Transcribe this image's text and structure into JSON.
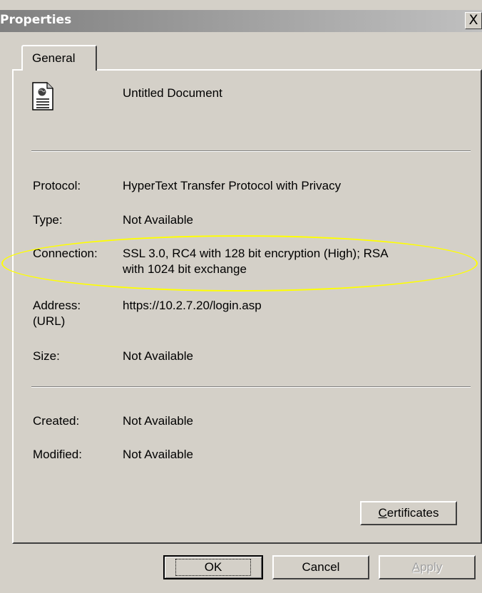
{
  "window": {
    "title": "Properties",
    "close_glyph": "X"
  },
  "tabs": [
    {
      "label": "General",
      "selected": true
    }
  ],
  "document": {
    "icon": "web-document-icon",
    "name": "Untitled Document"
  },
  "fields": {
    "protocol": {
      "label": "Protocol:",
      "value": "HyperText Transfer Protocol with Privacy"
    },
    "type": {
      "label": "Type:",
      "value": "Not Available"
    },
    "connection": {
      "label": "Connection:",
      "value_line1": "SSL 3.0, RC4 with 128 bit encryption (High); RSA",
      "value_line2": "with 1024 bit exchange"
    },
    "address": {
      "label_line1": "Address:",
      "label_line2": "(URL)",
      "value": "https://10.2.7.20/login.asp"
    },
    "size": {
      "label": "Size:",
      "value": "Not Available"
    },
    "created": {
      "label": "Created:",
      "value": "Not Available"
    },
    "modified": {
      "label": "Modified:",
      "value": "Not Available"
    }
  },
  "buttons": {
    "certificates": {
      "mnemonic": "C",
      "rest": "ertificates"
    },
    "ok": "OK",
    "cancel": "Cancel",
    "apply": {
      "mnemonic": "A",
      "rest": "pply",
      "disabled": true
    }
  },
  "colors": {
    "dialog_bg": "#d4d0c8",
    "highlight_ellipse": "#ffff00",
    "title_gradient_start": "#808080",
    "title_gradient_end": "#c0c0c0"
  }
}
